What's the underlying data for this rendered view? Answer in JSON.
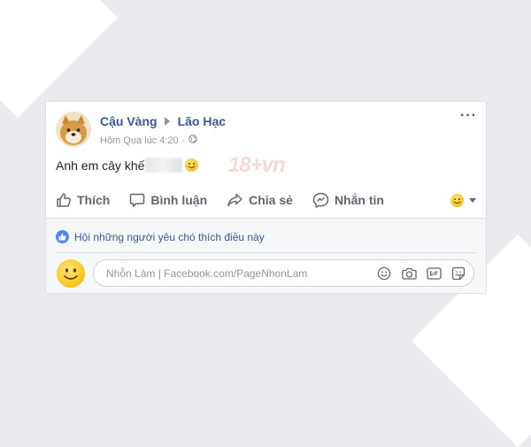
{
  "post": {
    "author": "Cậu Vàng",
    "target": "Lão Hạc",
    "timestamp": "Hôm Qua lúc 4:20",
    "separator": "·",
    "more": "···",
    "text": "Anh em cây khế"
  },
  "actions": {
    "like": "Thích",
    "comment": "Bình luận",
    "share": "Chia sẻ",
    "message": "Nhắn tin"
  },
  "likes_summary": "Hội những người yêu chó thích điều này",
  "comment_input": {
    "placeholder": "Nhỗn Làm | Facebook.com/PageNhonLam"
  },
  "colors": {
    "name_blue": "#365899",
    "action_gray": "#606770",
    "meta_gray": "#90949c",
    "like_blue": "#4e86f6"
  },
  "icons": [
    "privacy-globe-icon",
    "more-options-icon",
    "like-icon",
    "comment-icon",
    "share-icon",
    "messenger-icon",
    "reaction-smiley-icon",
    "emoji-icon",
    "camera-icon",
    "gif-icon",
    "sticker-icon"
  ]
}
